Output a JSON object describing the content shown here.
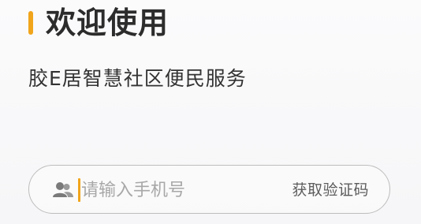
{
  "header": {
    "title": "欢迎使用",
    "subtitle": "胶E居智慧社区便民服务"
  },
  "login": {
    "phone_placeholder": "请输入手机号",
    "get_code_label": "获取验证码",
    "user_icon": "user-group-icon"
  },
  "colors": {
    "accent": "#f0a51c",
    "title_text": "#2c2c2c",
    "placeholder_text": "#a8a8a8",
    "input_border": "#bdbdbd"
  }
}
